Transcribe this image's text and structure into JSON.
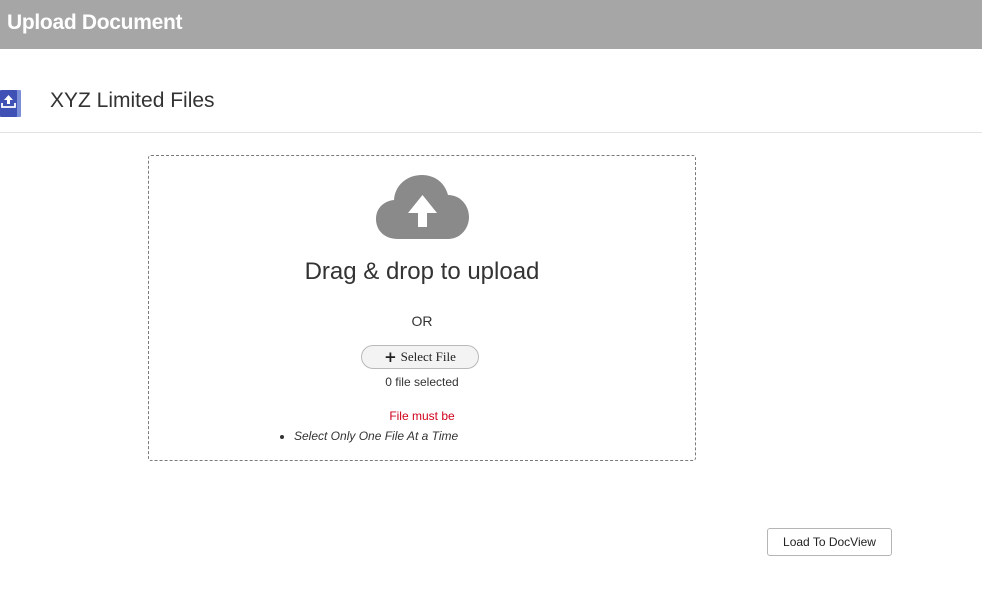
{
  "window": {
    "title": "Upload Document"
  },
  "section": {
    "title": "XYZ Limited Files",
    "icon": "upload-tray-icon",
    "icon_color": "#3f51b5"
  },
  "dropzone": {
    "cloud_icon": "cloud-upload-icon",
    "cloud_color": "#8a8a8a",
    "drag_text": "Drag & drop to upload",
    "or_text": "OR",
    "select_button_label": "Select File",
    "select_button_icon": "plus-icon",
    "file_count_text": "0 file selected",
    "warning_text": "File must be",
    "warning_color": "#d0021b",
    "rules": [
      "Select Only One File At a Time"
    ]
  },
  "actions": {
    "load_button_label": "Load To DocView"
  }
}
